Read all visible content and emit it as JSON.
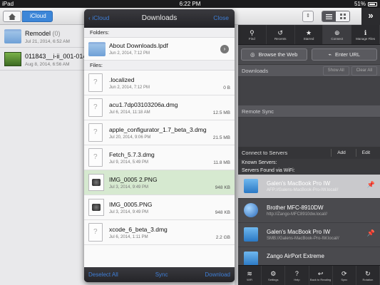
{
  "status": {
    "carrier": "iPad",
    "time": "6:22 PM",
    "battery": "51%"
  },
  "topbar": {
    "crumb": "iCloud",
    "expand": "»"
  },
  "left_items": [
    {
      "name": "Remodel",
      "count": "(0)",
      "date": "Jul 21, 2014, 6:52 AM"
    },
    {
      "name": "011843__i-ii_001-014",
      "count": "",
      "date": "Aug 8, 2014, 6:56 AM"
    }
  ],
  "popover": {
    "back": "iCloud",
    "title": "Downloads",
    "close": "Close",
    "folders_label": "Folders:",
    "files_label": "Files:",
    "folders": [
      {
        "name": "About Downloads.lpdf",
        "date": "Jun 2, 2014, 7:12 PM"
      }
    ],
    "files": [
      {
        "name": ".localized",
        "date": "Jun 2, 2014, 7:12 PM",
        "size": "0 B"
      },
      {
        "name": "acu1.7dp03103206a.dmg",
        "date": "Jul 6, 2014, 11:18 AM",
        "size": "12.5 MB"
      },
      {
        "name": "apple_configurator_1.7_beta_3.dmg",
        "date": "Jul 20, 2014, 9:06 PM",
        "size": "21.5 MB"
      },
      {
        "name": "Fetch_5.7.3.dmg",
        "date": "Jul 9, 2014, 5:49 PM",
        "size": "11.8 MB"
      },
      {
        "name": "IMG_0005 2.PNG",
        "date": "Jul 3, 2014, 9:49 PM",
        "size": "948 KB"
      },
      {
        "name": "IMG_0005.PNG",
        "date": "Jul 3, 2014, 9:49 PM",
        "size": "948 KB"
      },
      {
        "name": "xcode_6_beta_3.dmg",
        "date": "Jul 6, 2014, 1:11 PM",
        "size": "2.2 GB"
      }
    ],
    "footer": {
      "deselect": "Deselect All",
      "sync": "Sync",
      "download": "Download"
    }
  },
  "right": {
    "tools": [
      {
        "icon": "⚲",
        "label": "Find"
      },
      {
        "icon": "↺",
        "label": "Recents"
      },
      {
        "icon": "★",
        "label": "Starred"
      },
      {
        "icon": "⊕",
        "label": "Connect"
      },
      {
        "icon": "ℹ",
        "label": "Manage Files"
      }
    ],
    "browse": "Browse the Web",
    "enter_url": "Enter URL",
    "downloads": "Downloads",
    "show_all": "Show All",
    "clear_all": "Clear All",
    "remote_sync": "Remote Sync",
    "connect_servers": "Connect to Servers",
    "add": "Add",
    "edit": "Edit",
    "known_servers": "Known Servers:",
    "found_wifi": "Servers Found via WiFi:",
    "servers": [
      {
        "name": "Galen's MacBook Pro IW",
        "addr": "AFP://Galens-MacBook-Pro-IW.local//"
      },
      {
        "name": "Brother MFC-8910DW",
        "addr": "http://Zango-MFC8910dw.local//"
      },
      {
        "name": "Galen's MacBook Pro IW",
        "addr": "SMB://Galens-MacBook-Pro-IW.local//"
      },
      {
        "name": "Zango AirPort Extreme",
        "addr": ""
      }
    ],
    "bottom": [
      {
        "icon": "≋",
        "label": "WiFi"
      },
      {
        "icon": "⚙",
        "label": "Settings"
      },
      {
        "icon": "?",
        "label": "Help"
      },
      {
        "icon": "↩",
        "label": "Back to Reading"
      },
      {
        "icon": "⟳",
        "label": "Sync"
      },
      {
        "icon": "↻",
        "label": "Rotation"
      }
    ]
  }
}
